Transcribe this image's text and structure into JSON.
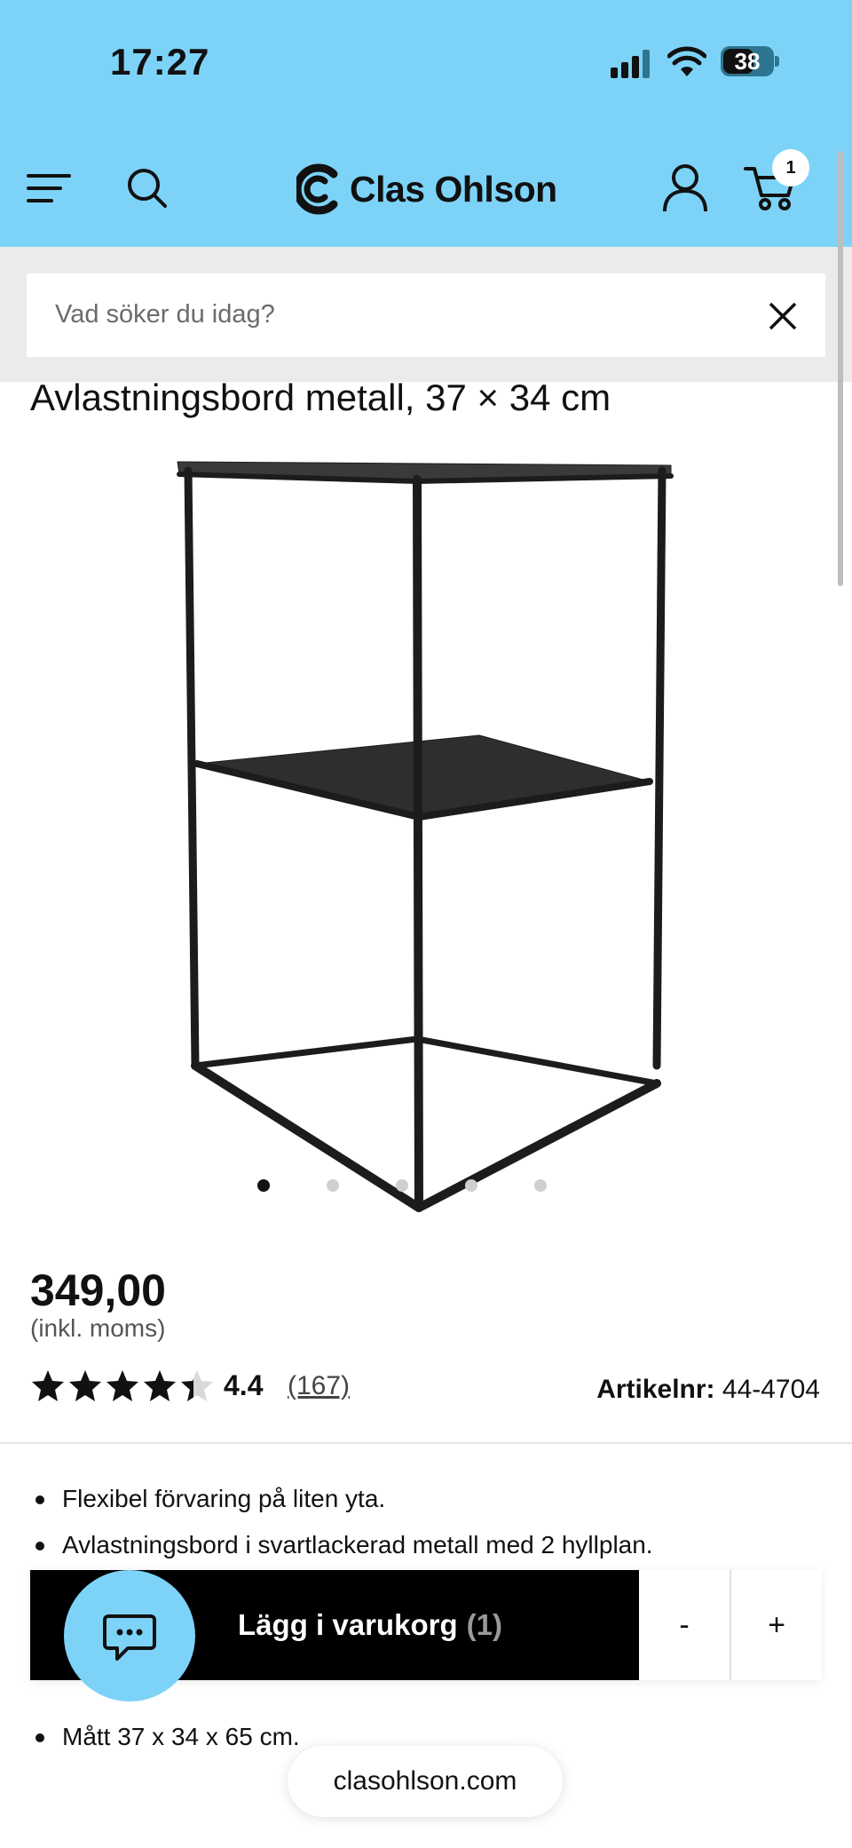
{
  "status_bar": {
    "time": "17:27",
    "battery": "38"
  },
  "header": {
    "brand": "Clas Ohlson",
    "cart_count": "1"
  },
  "search": {
    "placeholder": "Vad söker du idag?"
  },
  "product": {
    "title": "Avlastningsbord metall, 37 × 34 cm",
    "price": "349,00",
    "vat_note": "(inkl. moms)",
    "rating": "4.4",
    "rating_fraction": 0.88,
    "review_count": "(167)",
    "article_label": "Artikelnr:",
    "article_number": "44-4704",
    "gallery": {
      "total": 5,
      "active": 0
    },
    "bullets": [
      "Flexibel förvaring på liten yta.",
      "Avlastningsbord i svartlackerad metall med 2 hyllplan.",
      "Mått 37 x 34 x 65 cm."
    ]
  },
  "cart_bar": {
    "label": "Lägg i varukorg",
    "count": "(1)",
    "minus": "-",
    "plus": "+"
  },
  "browser": {
    "url": "clasohlson.com"
  },
  "colors": {
    "brand": "#7dd3f7",
    "cta": "#000000"
  }
}
